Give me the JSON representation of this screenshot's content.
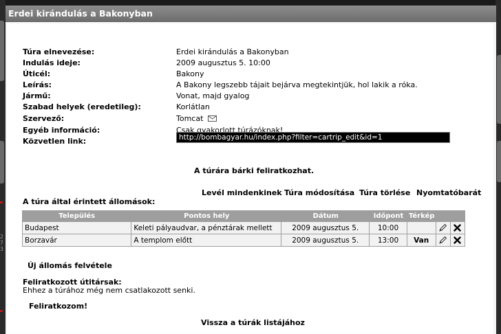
{
  "window": {
    "title": "Erdei kirándulás a Bakonyban"
  },
  "trip_info": [
    {
      "label": "Túra elnevezése:",
      "value": "Erdei kirándulás a Bakonyban"
    },
    {
      "label": "Indulás ideje:",
      "value": "2009 augusztus 5. 10:00"
    },
    {
      "label": "Úticél:",
      "value": "Bakony"
    },
    {
      "label": "Leírás:",
      "value": "A Bakony legszebb tájait bejárva megtekintjük, hol lakik a róka."
    },
    {
      "label": "Jármű:",
      "value": "Vonat, majd gyalog"
    },
    {
      "label": "Szabad helyek (eredetileg):",
      "value": "Korlátlan"
    },
    {
      "label": "Szervező:",
      "value": "Tomcat"
    },
    {
      "label": "Egyéb információ:",
      "value": "Csak gyakorlott túrázóknak!"
    },
    {
      "label": "Közvetlen link:",
      "value": "http://bombagyar.hu/index.php?filter=cartrip_edit&id=1"
    }
  ],
  "open_notice": "A túrára bárki feliratkozhat.",
  "actions": {
    "letter_all": "Levél mindenkinek",
    "edit_trip": "Túra módosítása",
    "delete_trip": "Túra törlése",
    "print_friendly": "Nyomtatóbarát"
  },
  "stations_heading": "A túra által érintett állomások:",
  "stations_table": {
    "headers": [
      "Település",
      "Pontos hely",
      "Dátum",
      "Időpont",
      "Térkép"
    ],
    "rows": [
      {
        "town": "Budapest",
        "place": "Keleti pályaudvar, a pénztárak mellett",
        "date": "2009 augusztus 5.",
        "time": "10:00",
        "map": ""
      },
      {
        "town": "Borzavár",
        "place": "A templom előtt",
        "date": "2009 augusztus 5.",
        "time": "13:00",
        "map": "Van"
      }
    ]
  },
  "new_station": "Új állomás felvétele",
  "participants": {
    "heading": "Feliratkozott útitársak:",
    "empty_text": "Ehhez a túrához még nem csatlakozott senki."
  },
  "signup": "Feliratkozom!",
  "back_link": "Vissza a túrák listájához",
  "side_digits": [
    "2",
    "7",
    "3"
  ],
  "colors": {
    "title_bar": "#7c7c7c",
    "table_header": "#9e9e9e",
    "link_box_bg": "#000000",
    "red_marker": "#cc1111"
  }
}
